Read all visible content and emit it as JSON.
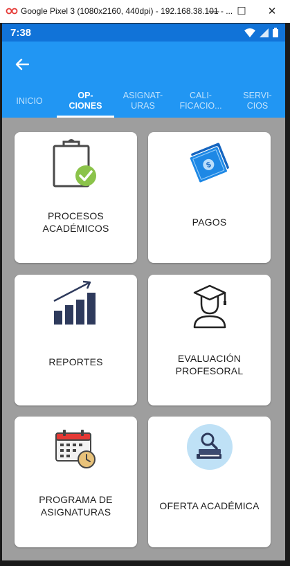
{
  "window": {
    "title": "Google Pixel 3 (1080x2160, 440dpi) - 192.168.38.101 - ...",
    "minimize_glyph": "—",
    "maximize_glyph": "☐",
    "close_glyph": "✕"
  },
  "status_bar": {
    "time": "7:38"
  },
  "tabs": [
    {
      "line1": "INICIO",
      "line2": "",
      "active": false
    },
    {
      "line1": "OP-",
      "line2": "CIONES",
      "active": true
    },
    {
      "line1": "ASIGNAT-",
      "line2": "URAS",
      "active": false
    },
    {
      "line1": "CALI-",
      "line2": "FICACIO...",
      "active": false
    },
    {
      "line1": "SERVI-",
      "line2": "CIOS",
      "active": false
    }
  ],
  "cards": [
    {
      "line1": "PROCESOS",
      "line2": "ACADÉMICOS",
      "icon": "clipboard-check-icon"
    },
    {
      "line1": "PAGOS",
      "line2": "",
      "icon": "money-bills-icon"
    },
    {
      "line1": "REPORTES",
      "line2": "",
      "icon": "bar-chart-growth-icon"
    },
    {
      "line1": "EVALUACIÓN",
      "line2": "PROFESORAL",
      "icon": "teacher-graduate-icon"
    },
    {
      "line1": "PROGRAMA DE",
      "line2": "ASIGNATURAS",
      "icon": "calendar-clock-icon"
    },
    {
      "line1": "OFERTA ACADÉMICA",
      "line2": "",
      "icon": "books-search-icon"
    }
  ],
  "colors": {
    "app_bar": "#2196f3",
    "status_bar": "#1173d8",
    "content_bg": "#9e9e9e",
    "check_green": "#8bc34a",
    "money_blue": "#1e88e5",
    "chart_navy": "#2e3a5c"
  }
}
